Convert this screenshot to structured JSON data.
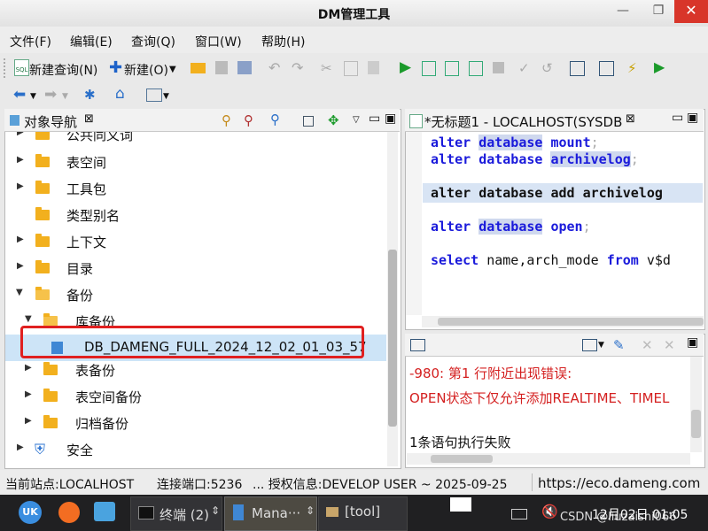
{
  "window": {
    "title": "DM管理工具"
  },
  "menu": [
    "文件(F)",
    "编辑(E)",
    "查询(Q)",
    "窗口(W)",
    "帮助(H)"
  ],
  "toolbar": {
    "new_query": "新建查询(N)",
    "new": "新建(O)"
  },
  "navigator": {
    "tab_label": "对象导航",
    "items": [
      {
        "label": "公共同义词",
        "level": 1,
        "state": "collapsed"
      },
      {
        "label": "表空间",
        "level": 1,
        "state": "collapsed"
      },
      {
        "label": "工具包",
        "level": 1,
        "state": "collapsed"
      },
      {
        "label": "类型别名",
        "level": 1,
        "state": "leaf"
      },
      {
        "label": "上下文",
        "level": 1,
        "state": "collapsed"
      },
      {
        "label": "目录",
        "level": 1,
        "state": "collapsed"
      },
      {
        "label": "备份",
        "level": 1,
        "state": "expanded"
      },
      {
        "label": "库备份",
        "level": 2,
        "state": "expanded"
      },
      {
        "label": "DB_DAMENG_FULL_2024_12_02_01_03_57",
        "level": 3,
        "state": "selected"
      },
      {
        "label": "表备份",
        "level": 2,
        "state": "collapsed"
      },
      {
        "label": "表空间备份",
        "level": 2,
        "state": "collapsed"
      },
      {
        "label": "归档备份",
        "level": 2,
        "state": "collapsed"
      },
      {
        "label": "安全",
        "level": 1,
        "state": "collapsed"
      }
    ]
  },
  "editor": {
    "tab_label": "*无标题1 - LOCALHOST(SYSDB",
    "lines": [
      {
        "a": "alter",
        "b": "database",
        "c": "mount",
        "d": ";"
      },
      {
        "a": "alter",
        "b": "database",
        "c": "archivelog",
        "d": ";"
      },
      {
        "a": "alter",
        "b": "database",
        "c": "add archivelog",
        "d": ""
      },
      {
        "a": "alter",
        "b": "database",
        "c": "open",
        "d": ";"
      },
      {
        "a": "select",
        "b": "name",
        "c": "arch_mode",
        "d": "from",
        "e": "v$d"
      }
    ]
  },
  "output": {
    "line1": "-980: 第1 行附近出现错误:",
    "line2": "OPEN状态下仅允许添加REALTIME、TIMEL",
    "line3": "1条语句执行失败"
  },
  "status": {
    "site": "当前站点:LOCALHOST",
    "port": "连接端口:5236",
    "license": "... 授权信息:DEVELOP USER ~ 2025-09-25",
    "url": "https://eco.dameng.com"
  },
  "taskbar": {
    "terminal": "终端 (2)",
    "manager": "Mana···",
    "folder": "[tool]",
    "clock": "12月02日 01:05",
    "watermark": "CSDN @liuzaishi066"
  },
  "colors": {
    "error": "#d42020",
    "keyword": "#1a1adb",
    "selection": "#cde4f7",
    "highlight_box": "#e02020"
  }
}
